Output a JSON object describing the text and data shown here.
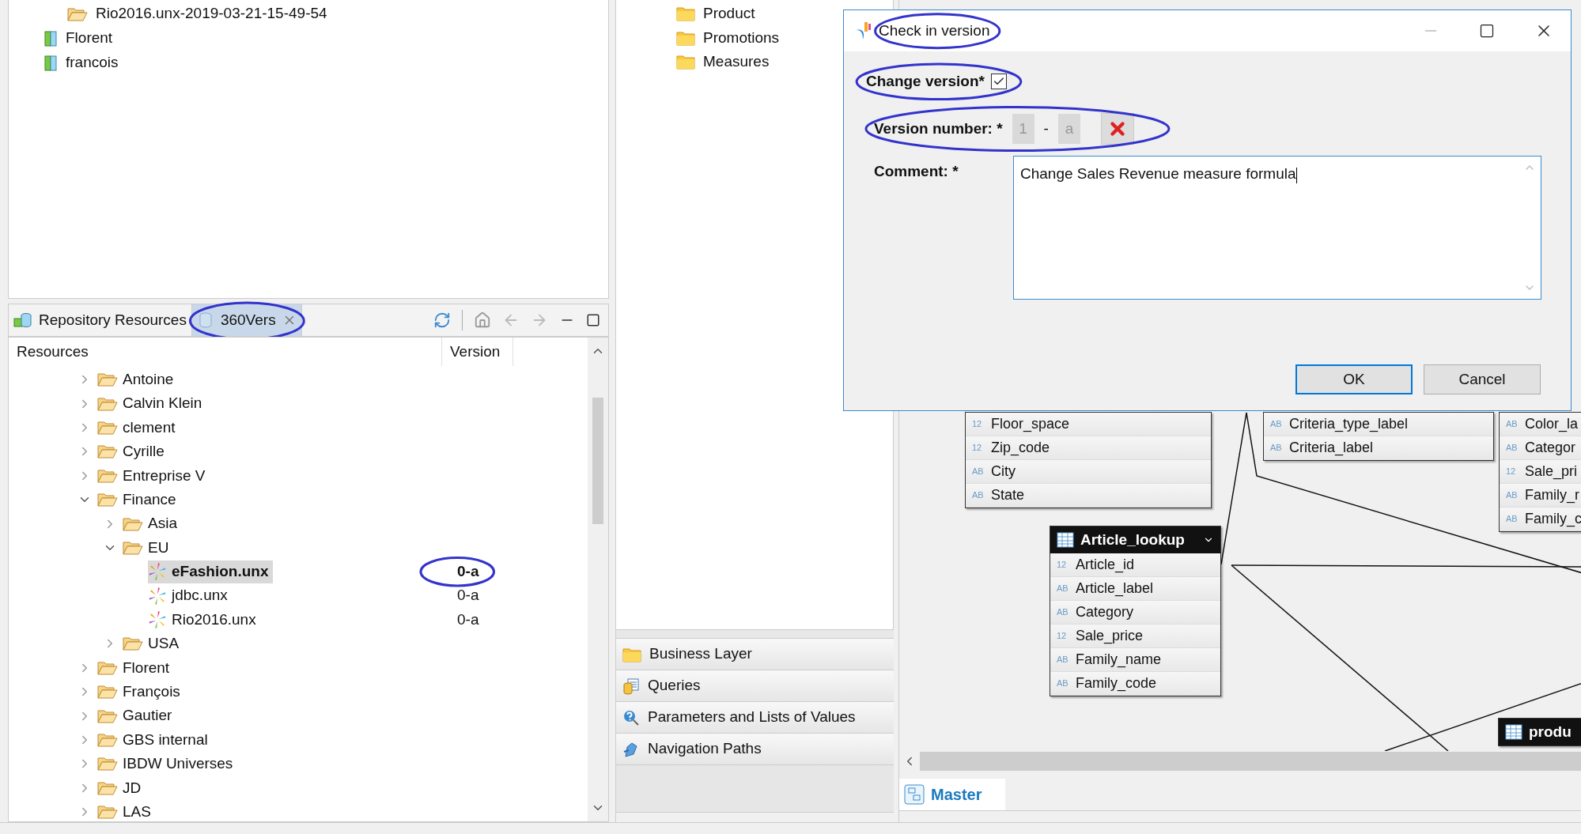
{
  "top_tree": [
    {
      "label": "Rio2016.unx-2019-03-21-15-49-54",
      "kind": "folder"
    },
    {
      "label": "Florent",
      "kind": "user"
    },
    {
      "label": "francois",
      "kind": "user"
    }
  ],
  "left_tabs": [
    {
      "label": "Repository Resources",
      "selected": false,
      "highlighted": false
    },
    {
      "label": "360Vers",
      "selected": true,
      "highlighted": true
    }
  ],
  "resources": {
    "columns": [
      "Resources",
      "Version"
    ],
    "rows": [
      {
        "label": "Antoine",
        "kind": "folder",
        "expanded": false,
        "selected": false
      },
      {
        "label": "Calvin Klein",
        "kind": "folder",
        "expanded": false,
        "selected": false
      },
      {
        "label": "clement",
        "kind": "folder",
        "expanded": false,
        "selected": false
      },
      {
        "label": "Cyrille",
        "kind": "folder",
        "expanded": false,
        "selected": false
      },
      {
        "label": "Entreprise V",
        "kind": "folder",
        "expanded": false,
        "selected": false
      },
      {
        "label": "Finance",
        "kind": "folder",
        "expanded": true,
        "selected": false,
        "children": [
          {
            "label": "Asia",
            "kind": "folder",
            "expanded": false,
            "selected": false
          },
          {
            "label": "EU",
            "kind": "folder",
            "expanded": true,
            "selected": false,
            "children": [
              {
                "label": "eFashion.unx",
                "kind": "universe",
                "selected": true,
                "version": "0-a",
                "highlighted": true
              },
              {
                "label": "jdbc.unx",
                "kind": "universe",
                "selected": false,
                "version": "0-a",
                "highlighted": false
              },
              {
                "label": "Rio2016.unx",
                "kind": "universe",
                "selected": false,
                "version": "0-a",
                "highlighted": false
              }
            ]
          },
          {
            "label": "USA",
            "kind": "folder",
            "expanded": false,
            "selected": false
          }
        ]
      },
      {
        "label": "Florent",
        "kind": "folder",
        "expanded": false,
        "selected": false
      },
      {
        "label": "François",
        "kind": "folder",
        "expanded": false,
        "selected": false
      },
      {
        "label": "Gautier",
        "kind": "folder",
        "expanded": false,
        "selected": false
      },
      {
        "label": "GBS internal",
        "kind": "folder",
        "expanded": false,
        "selected": false
      },
      {
        "label": "IBDW Universes",
        "kind": "folder",
        "expanded": false,
        "selected": false
      },
      {
        "label": "JD",
        "kind": "folder",
        "expanded": false,
        "selected": false
      },
      {
        "label": "LAS",
        "kind": "folder",
        "expanded": false,
        "selected": false
      }
    ]
  },
  "outline": [
    "Product",
    "Promotions",
    "Measures"
  ],
  "accordion": [
    {
      "label": "Business Layer",
      "kind": "folder"
    },
    {
      "label": "Queries",
      "kind": "queries"
    },
    {
      "label": "Parameters and Lists of Values",
      "kind": "parameters"
    },
    {
      "label": "Navigation Paths",
      "kind": "navigation"
    }
  ],
  "diagram": {
    "tables": [
      {
        "columns": [
          {
            "type": "12",
            "name": "Floor_space"
          },
          {
            "type": "12",
            "name": "Zip_code"
          },
          {
            "type": "AB",
            "name": "City"
          },
          {
            "type": "AB",
            "name": "State"
          }
        ]
      },
      {
        "columns": [
          {
            "type": "AB",
            "name": "Criteria_type_label"
          },
          {
            "type": "AB",
            "name": "Criteria_label"
          }
        ]
      },
      {
        "columns": [
          {
            "type": "AB",
            "name": "Color_la"
          },
          {
            "type": "AB",
            "name": "Categor"
          },
          {
            "type": "12",
            "name": "Sale_pri"
          },
          {
            "type": "AB",
            "name": "Family_r"
          },
          {
            "type": "AB",
            "name": "Family_c"
          }
        ]
      },
      {
        "header": "Article_lookup",
        "columns": [
          {
            "type": "12",
            "name": "Article_id"
          },
          {
            "type": "AB",
            "name": "Article_label"
          },
          {
            "type": "AB",
            "name": "Category"
          },
          {
            "type": "12",
            "name": "Sale_price"
          },
          {
            "type": "AB",
            "name": "Family_name"
          },
          {
            "type": "AB",
            "name": "Family_code"
          }
        ]
      },
      {
        "header": "produ"
      }
    ]
  },
  "bottom_tabs": [
    {
      "label": "Master",
      "selected": true
    }
  ],
  "dialog": {
    "title": "Check in version",
    "title_highlighted": true,
    "change_version": {
      "label": "Change version*",
      "checked": true,
      "highlighted": true
    },
    "version_number": {
      "label": "Version number: *",
      "major": "1",
      "separator": "-",
      "minor": "a",
      "highlighted": true
    },
    "comment": {
      "label": "Comment: *",
      "value": "Change Sales Revenue measure formula"
    },
    "buttons": [
      {
        "label": "OK",
        "default": true
      },
      {
        "label": "Cancel",
        "default": false
      }
    ]
  }
}
